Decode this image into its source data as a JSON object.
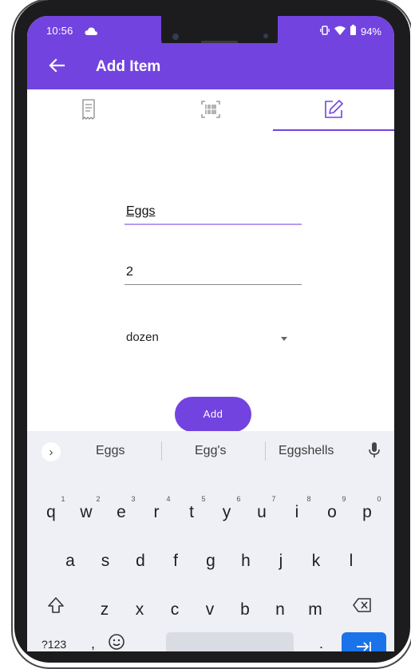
{
  "status_bar": {
    "time": "10:56",
    "battery_text": "94%",
    "icons": [
      "cloud-icon",
      "vibrate-icon",
      "wifi-icon",
      "battery-icon"
    ]
  },
  "app_bar": {
    "back_icon": "arrow-left-icon",
    "title": "Add Item"
  },
  "tabs": [
    {
      "icon": "receipt-icon",
      "selected": false
    },
    {
      "icon": "barcode-scan-icon",
      "selected": false
    },
    {
      "icon": "edit-icon",
      "selected": true
    }
  ],
  "form": {
    "name_value": "Eggs",
    "quantity_value": "2",
    "unit_selected": "dozen",
    "add_label": "Add"
  },
  "keyboard": {
    "suggestions": [
      "Eggs",
      "Egg's",
      "Eggshells"
    ],
    "row1": [
      "q",
      "w",
      "e",
      "r",
      "t",
      "y",
      "u",
      "i",
      "o",
      "p"
    ],
    "row1_hints": [
      "1",
      "2",
      "3",
      "4",
      "5",
      "6",
      "7",
      "8",
      "9",
      "0"
    ],
    "row2": [
      "a",
      "s",
      "d",
      "f",
      "g",
      "h",
      "j",
      "k",
      "l"
    ],
    "row3": [
      "z",
      "x",
      "c",
      "v",
      "b",
      "n",
      "m"
    ],
    "symbols_label": "?123",
    "comma": ",",
    "period": "."
  },
  "colors": {
    "accent": "#7343e0",
    "keyboard_bg": "#eef0f6",
    "enter_key": "#1a73e8"
  }
}
